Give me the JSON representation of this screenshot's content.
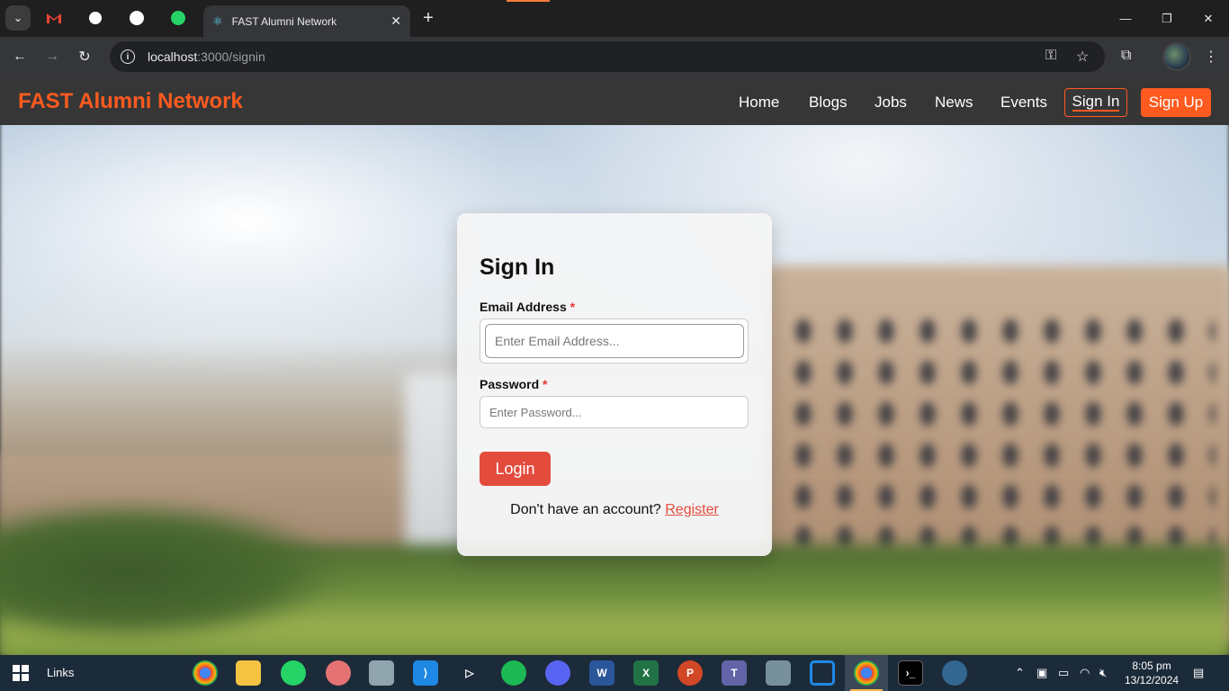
{
  "browser": {
    "tab_title": "FAST Alumni Network",
    "url_host": "localhost",
    "url_path": ":3000/signin"
  },
  "site": {
    "brand": "FAST Alumni Network",
    "nav": [
      "Home",
      "Blogs",
      "Jobs",
      "News",
      "Events"
    ],
    "signin_label": "Sign In",
    "signup_label": "Sign Up",
    "accent_color": "#ff5a1f"
  },
  "form": {
    "title": "Sign In",
    "email_label": "Email Address",
    "email_placeholder": "Enter Email Address...",
    "password_label": "Password",
    "password_placeholder": "Enter Password...",
    "required_mark": "*",
    "login_label": "Login",
    "register_prompt": "Don't have an account?",
    "register_link": "Register"
  },
  "taskbar": {
    "links_label": "Links",
    "time": "8:05 pm",
    "date": "13/12/2024"
  }
}
